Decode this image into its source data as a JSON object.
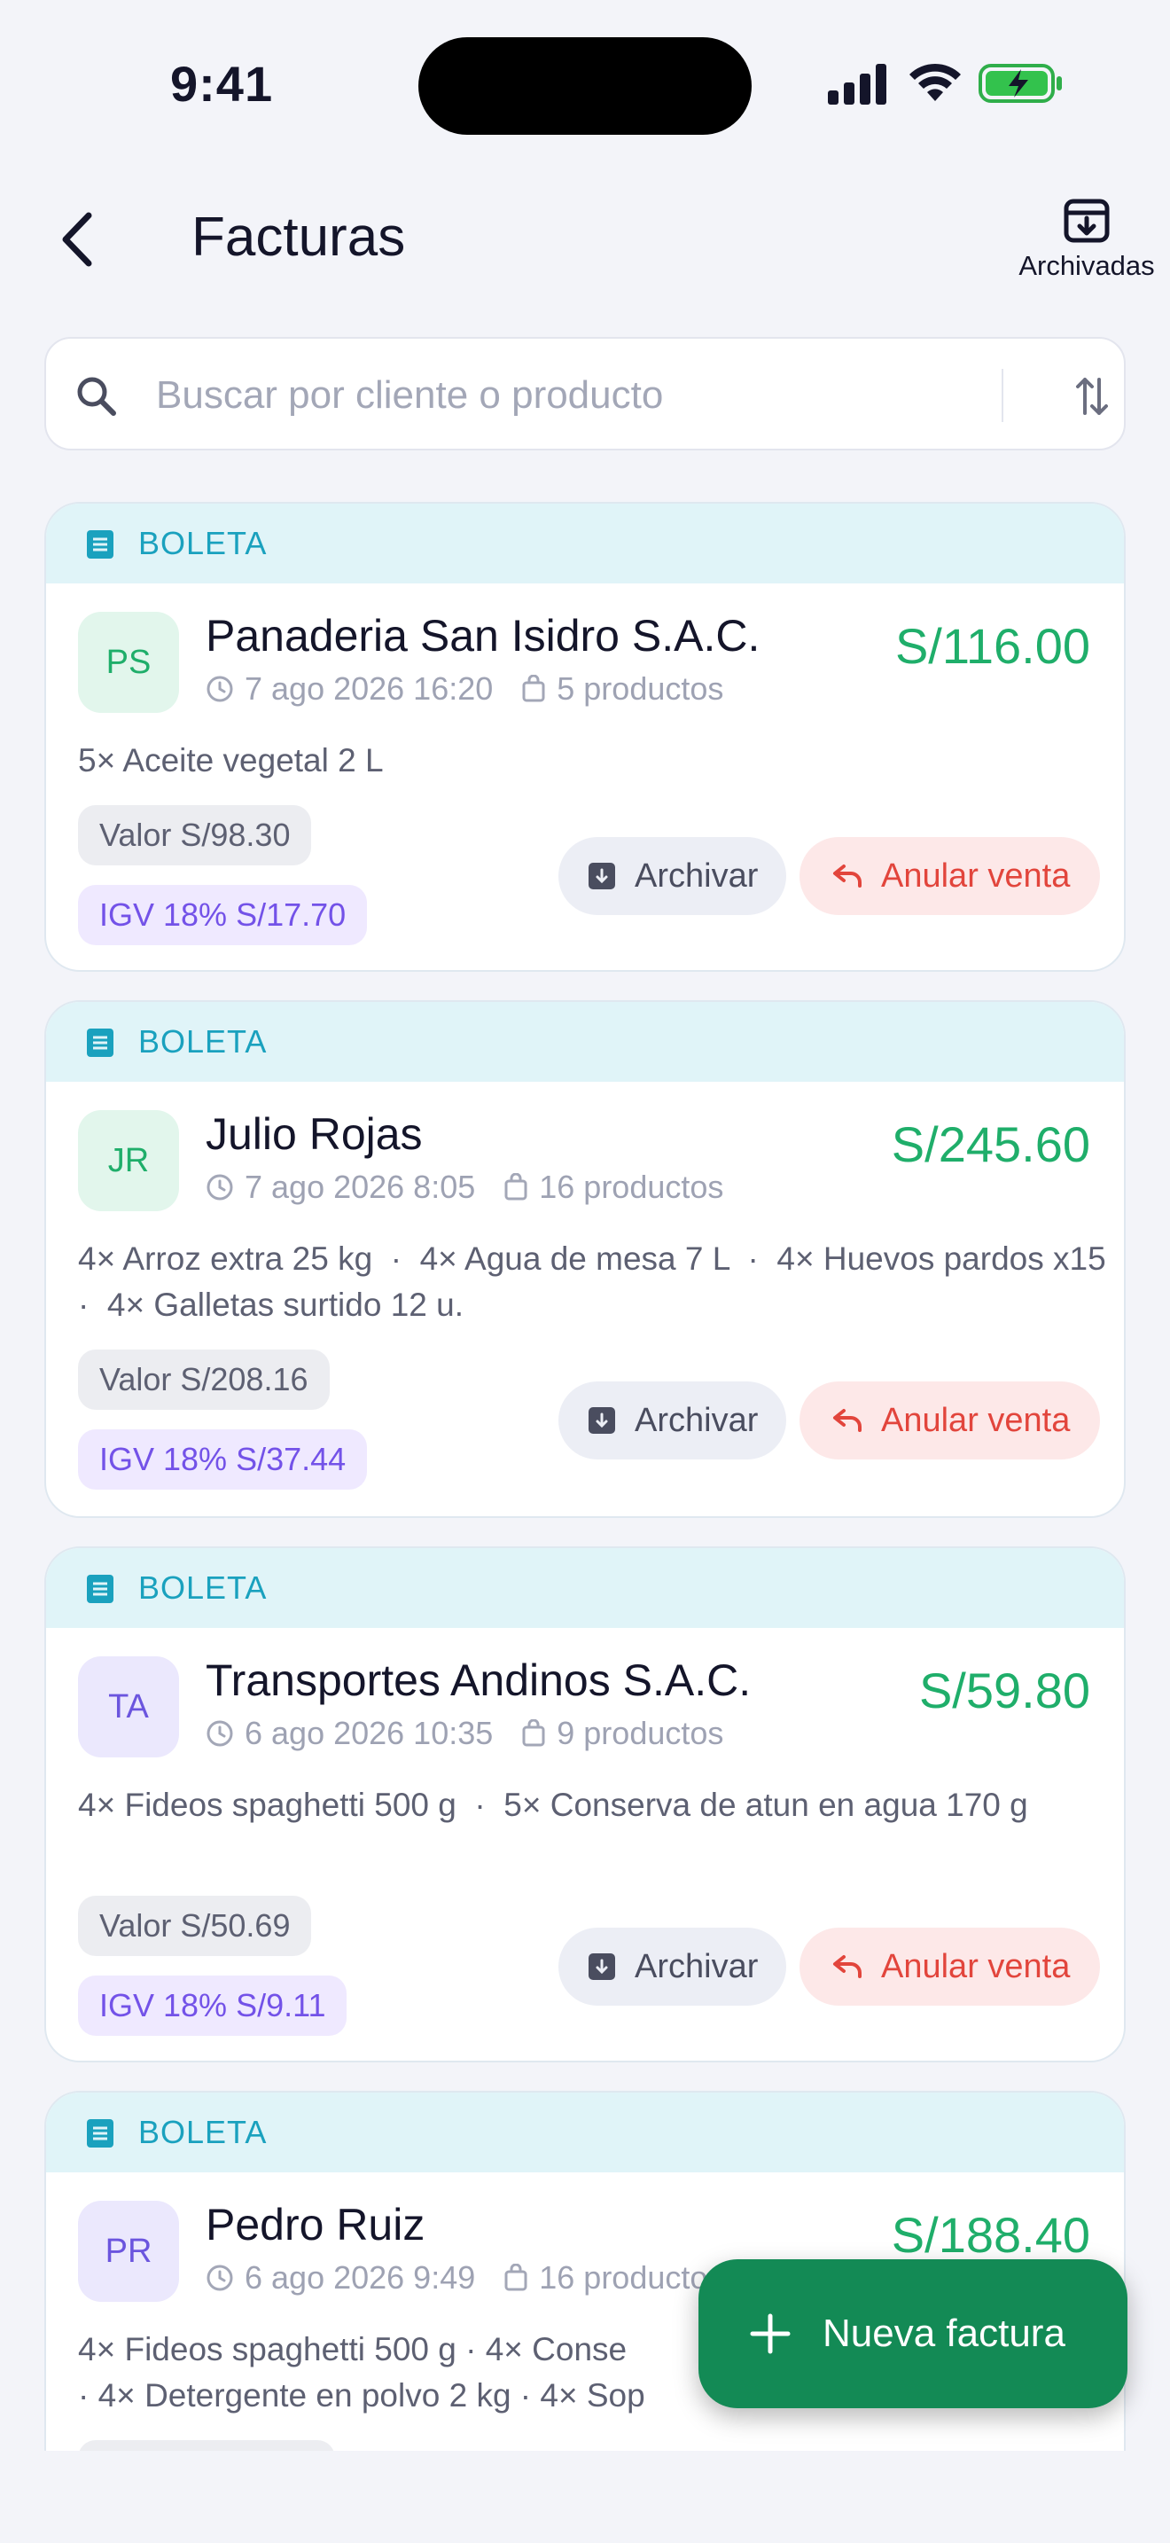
{
  "status_bar": {
    "time": "9:41"
  },
  "header": {
    "title": "Facturas",
    "archived_label": "Archivadas"
  },
  "search": {
    "placeholder": "Buscar por cliente o producto",
    "value": ""
  },
  "colors": {
    "accent": "#138a55",
    "amount": "#1fae6a",
    "doc_type": "#1aa1be",
    "void": "#e2453c",
    "igv": "#7352e8"
  },
  "cards": [
    {
      "doc_type": "BOLETA",
      "initials": "PS",
      "client": "Panaderia San Isidro S.A.C.",
      "total": "S/116.00",
      "date": "7 ago 2026 16:20",
      "products": "5 productos",
      "items": "5× Aceite vegetal 2 L",
      "value": "Valor S/98.30",
      "igv": "IGV 18% S/17.70",
      "archive_label": "Archivar",
      "void_label": "Anular venta"
    },
    {
      "doc_type": "BOLETA",
      "initials": "JR",
      "client": "Julio Rojas",
      "total": "S/245.60",
      "date": "7 ago 2026 8:05",
      "products": "16 productos",
      "items": "4× Arroz extra 25 kg  ·  4× Agua de mesa 7 L  ·  4× Huevos pardos x15  ·  4× Galletas surtido 12 u.",
      "value": "Valor S/208.16",
      "igv": "IGV 18% S/37.44",
      "archive_label": "Archivar",
      "void_label": "Anular venta"
    },
    {
      "doc_type": "BOLETA",
      "initials": "TA",
      "client": "Transportes Andinos S.A.C.",
      "total": "S/59.80",
      "date": "6 ago 2026 10:35",
      "products": "9 productos",
      "items": "4× Fideos spaghetti 500 g  ·  5× Conserva de atun en agua 170 g",
      "value": "Valor S/50.69",
      "igv": "IGV 18% S/9.11",
      "archive_label": "Archivar",
      "void_label": "Anular venta"
    },
    {
      "doc_type": "BOLETA",
      "initials": "PR",
      "client": "Pedro Ruiz",
      "total": "S/188.40",
      "date": "6 ago 2026 9:49",
      "products": "16 productos",
      "items": "4× Fideos spaghetti 500 g  ·  4× Conse",
      "items_line2": "·  4× Detergente en polvo 2 kg  ·  4× Sop"
    }
  ],
  "fab": {
    "label": "Nueva factura"
  }
}
